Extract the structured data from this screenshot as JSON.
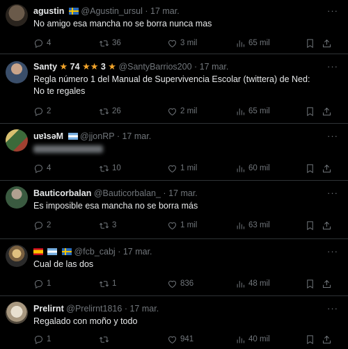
{
  "tweets": [
    {
      "name": "agustin",
      "handle": "@Agustin_ursul",
      "date": "17 mar.",
      "text": "No amigo esa mancha no se borra nunca mas",
      "replies": "4",
      "reposts": "36",
      "likes": "3 mil",
      "views": "65 mil",
      "flags": [
        "sweden"
      ]
    },
    {
      "name": "Santy",
      "badge_num1": "74",
      "badge_num2": "3",
      "handle": "@SantyBarrios200",
      "date": "17 mar.",
      "text": "Regla número 1 del Manual de Supervivencia Escolar (twittera) de Ned: No te regales",
      "replies": "2",
      "reposts": "26",
      "likes": "2 mil",
      "views": "65 mil"
    },
    {
      "name": "uɐʇsǝM",
      "handle": "@jjonRP",
      "date": "17 mar.",
      "text": "",
      "replies": "4",
      "reposts": "10",
      "likes": "1 mil",
      "views": "60 mil",
      "flags": [
        "argentina"
      ]
    },
    {
      "name": "Bauticorbalan",
      "handle": "@Bauticorbalan_",
      "date": "17 mar.",
      "text": "Es imposible esa mancha no se borra más",
      "replies": "2",
      "reposts": "3",
      "likes": "1 mil",
      "views": "63 mil"
    },
    {
      "name": "",
      "handle": "@fcb_cabj",
      "date": "17 mar.",
      "text": "Cual de las dos",
      "replies": "1",
      "reposts": "1",
      "likes": "836",
      "views": "48 mil",
      "flags": [
        "spain",
        "argentina",
        "sweden"
      ]
    },
    {
      "name": "Prelirnt",
      "handle": "@Prelirnt1816",
      "date": "17 mar.",
      "text": "Regalado con moño y todo",
      "replies": "1",
      "reposts": "",
      "likes": "941",
      "views": "40 mil"
    }
  ],
  "separator": "·",
  "more_label": "···",
  "icons": [
    "reply-icon",
    "repost-icon",
    "like-icon",
    "views-icon",
    "bookmark-icon",
    "share-icon"
  ],
  "colors": {
    "background": "#000000",
    "text": "#e7e9ea",
    "muted": "#71767b",
    "border": "#2f3336",
    "star": "#f4a52a"
  }
}
